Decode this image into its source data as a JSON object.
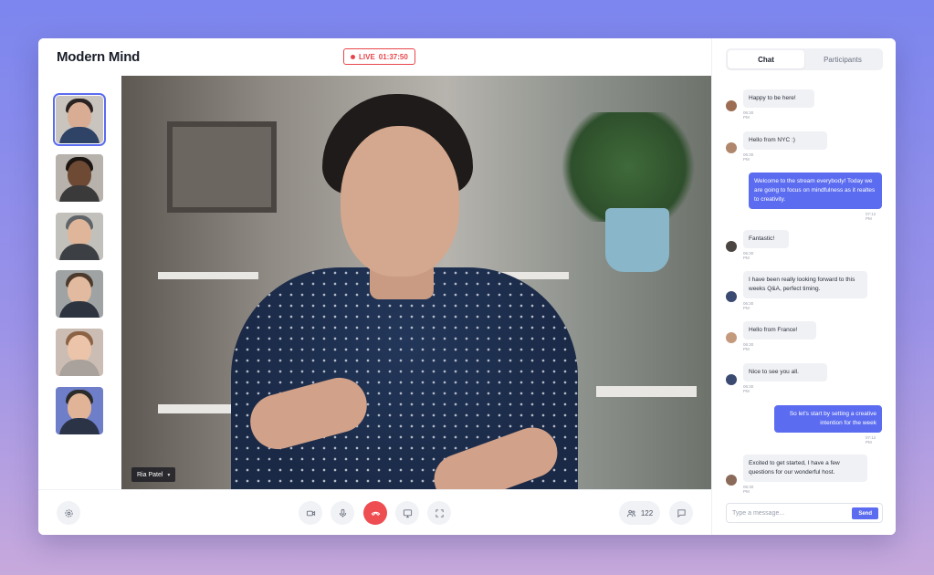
{
  "app": {
    "brand": "Modern Mind"
  },
  "live": {
    "label": "LIVE",
    "time": "01:37:50"
  },
  "video": {
    "speaker_name": "Ria Patel"
  },
  "thumbnails": [
    {
      "skin": "#d9ad93",
      "hair": "#2a2321",
      "shirt": "#2f4366",
      "bg": "#c9c4be"
    },
    {
      "skin": "#6e4a35",
      "hair": "#1c1512",
      "shirt": "#3b3a3a",
      "bg": "#b7b2ac"
    },
    {
      "skin": "#e0b69a",
      "hair": "#5e6468",
      "shirt": "#3c3f43",
      "bg": "#c2c0bb"
    },
    {
      "skin": "#e2ba9f",
      "hair": "#4c3a2c",
      "shirt": "#2d3440",
      "bg": "#9fa3a4"
    },
    {
      "skin": "#ebc4a9",
      "hair": "#8c6244",
      "shirt": "#a9a19b",
      "bg": "#cbbdb3"
    },
    {
      "skin": "#e1b497",
      "hair": "#2b2b2b",
      "shirt": "#2b3447",
      "bg": "#6f7ec9"
    }
  ],
  "controls": {
    "participant_count": "122"
  },
  "chat": {
    "tabs": [
      "Chat",
      "Participants"
    ],
    "placeholder": "Type a message...",
    "send_label": "Send",
    "messages": [
      {
        "text": "Happy to be here!",
        "time": "06:30 PM",
        "mine": false,
        "avatar": "#9c6d52"
      },
      {
        "text": "Hello from NYC :)",
        "time": "06:30 PM",
        "mine": false,
        "avatar": "#b0866c"
      },
      {
        "text": "Welcome to the stream everybody! Today we are going to focus on mindfulness as it realtes to creativity.",
        "time": "07:12 PM",
        "mine": true
      },
      {
        "text": "Fantastic!",
        "time": "06:30 PM",
        "mine": false,
        "avatar": "#4a4540"
      },
      {
        "text": "I have been really looking forward to this weeks Q&A, perfect timing.",
        "time": "06:30 PM",
        "mine": false,
        "avatar": "#3a4a70"
      },
      {
        "text": "Hello from France!",
        "time": "06:30 PM",
        "mine": false,
        "avatar": "#c49a7d"
      },
      {
        "text": "Nice to see you all.",
        "time": "06:30 PM",
        "mine": false,
        "avatar": "#3a4a70"
      },
      {
        "text": "So let's start by setting a creative intention for the week",
        "time": "07:12 PM",
        "mine": true
      },
      {
        "text": "Excited to get started, I have a few questions for our wonderful host.",
        "time": "06:30 PM",
        "mine": false,
        "avatar": "#8a6a58"
      }
    ]
  },
  "colors": {
    "accent": "#5b6cf0",
    "live": "#e8454b",
    "end_call": "#ee4d52"
  },
  "icons": [
    "settings-icon",
    "camera-icon",
    "microphone-icon",
    "end-call-icon",
    "screen-share-icon",
    "fullscreen-icon",
    "participants-icon",
    "chat-bubble-icon"
  ]
}
